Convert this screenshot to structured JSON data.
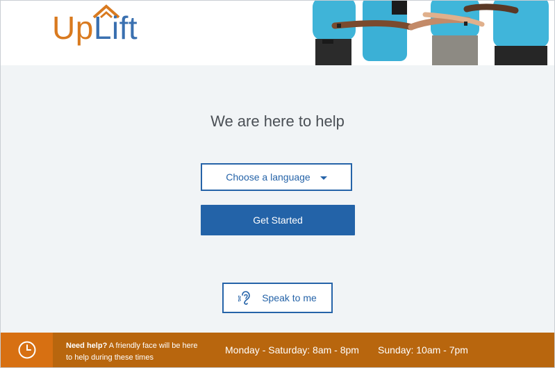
{
  "header": {
    "logo_up": "Up",
    "logo_lift": "Lift"
  },
  "main": {
    "headline": "We are here to help",
    "language_select": {
      "label": "Choose a language"
    },
    "get_started_label": "Get Started",
    "speak_label": "Speak to me"
  },
  "footer": {
    "help_bold": "Need help?",
    "help_text": " A friendly face will be here to help during these times",
    "weekday_hours": "Monday - Saturday: 8am - 8pm",
    "sunday_hours": "Sunday: 10am - 7pm"
  },
  "colors": {
    "brand_orange": "#d97a1f",
    "brand_blue": "#2363a8",
    "footer_bg": "#b8660e",
    "page_bg": "#f1f4f6"
  },
  "icons": {
    "logo_roof": "roof-icon",
    "language_caret": "caret-down-icon",
    "speak": "ear-icon",
    "hours": "clock-icon"
  }
}
